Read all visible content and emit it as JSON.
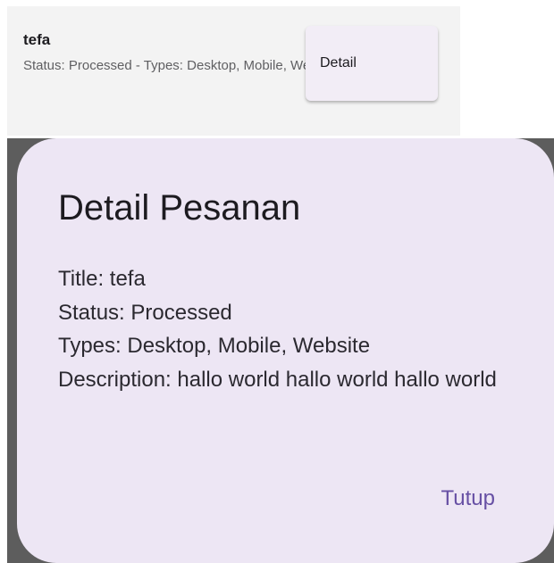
{
  "list_item": {
    "title": "tefa",
    "subtitle": "Status: Processed - Types: Desktop, Mobile, Website",
    "detail_button_label": "Detail"
  },
  "dialog": {
    "title": "Detail Pesanan",
    "lines": [
      "Title: tefa",
      "Status: Processed",
      "Types: Desktop, Mobile, Website",
      "Description: hallo world hallo world hallo world"
    ],
    "close_label": "Tutup"
  },
  "colors": {
    "dialog_background": "#ede6f4",
    "accent": "#6750a4",
    "scrim": "#5d5d5d"
  }
}
